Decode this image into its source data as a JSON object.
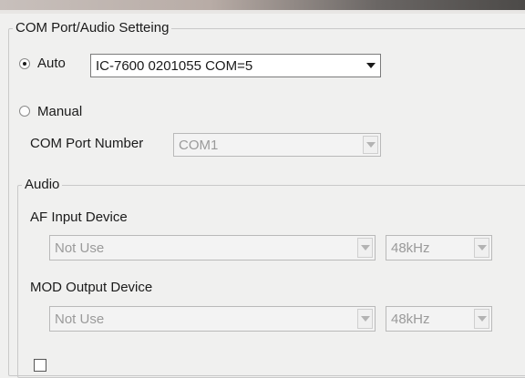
{
  "com_audio": {
    "title": "COM Port/Audio Setteing",
    "auto": {
      "label": "Auto",
      "selected": true,
      "device_value": "IC-7600 0201055 COM=5"
    },
    "manual": {
      "label": "Manual",
      "selected": false
    },
    "com_port": {
      "label": "COM Port Number",
      "value": "COM1",
      "enabled": false
    },
    "audio": {
      "title": "Audio",
      "af_input": {
        "label": "AF Input Device",
        "device_value": "Not Use",
        "rate_value": "48kHz"
      },
      "mod_output": {
        "label": "MOD Output Device",
        "device_value": "Not Use",
        "rate_value": "48kHz"
      }
    }
  },
  "icons": {
    "radio": "radio-button",
    "dropdown": "chevron-down-icon"
  }
}
